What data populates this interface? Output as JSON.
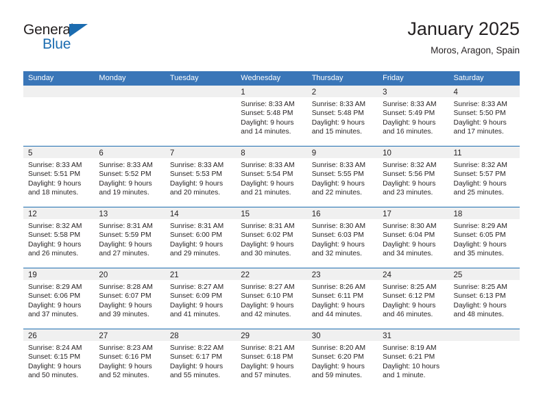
{
  "brand": {
    "name_top": "General",
    "name_bottom": "Blue",
    "triangle_icon": "brand-triangle-icon",
    "color_primary": "#1b6cb0",
    "color_text": "#231f20"
  },
  "header": {
    "title": "January 2025",
    "subtitle": "Moros, Aragon, Spain"
  },
  "calendar": {
    "header_background": "#3a76b8",
    "day_band_background": "#f0f0f0",
    "separator_color": "#1b6cb0",
    "weekdays": [
      "Sunday",
      "Monday",
      "Tuesday",
      "Wednesday",
      "Thursday",
      "Friday",
      "Saturday"
    ],
    "weeks": [
      [
        {
          "day": "",
          "lines": []
        },
        {
          "day": "",
          "lines": []
        },
        {
          "day": "",
          "lines": []
        },
        {
          "day": "1",
          "lines": [
            "Sunrise: 8:33 AM",
            "Sunset: 5:48 PM",
            "Daylight: 9 hours",
            "and 14 minutes."
          ]
        },
        {
          "day": "2",
          "lines": [
            "Sunrise: 8:33 AM",
            "Sunset: 5:48 PM",
            "Daylight: 9 hours",
            "and 15 minutes."
          ]
        },
        {
          "day": "3",
          "lines": [
            "Sunrise: 8:33 AM",
            "Sunset: 5:49 PM",
            "Daylight: 9 hours",
            "and 16 minutes."
          ]
        },
        {
          "day": "4",
          "lines": [
            "Sunrise: 8:33 AM",
            "Sunset: 5:50 PM",
            "Daylight: 9 hours",
            "and 17 minutes."
          ]
        }
      ],
      [
        {
          "day": "5",
          "lines": [
            "Sunrise: 8:33 AM",
            "Sunset: 5:51 PM",
            "Daylight: 9 hours",
            "and 18 minutes."
          ]
        },
        {
          "day": "6",
          "lines": [
            "Sunrise: 8:33 AM",
            "Sunset: 5:52 PM",
            "Daylight: 9 hours",
            "and 19 minutes."
          ]
        },
        {
          "day": "7",
          "lines": [
            "Sunrise: 8:33 AM",
            "Sunset: 5:53 PM",
            "Daylight: 9 hours",
            "and 20 minutes."
          ]
        },
        {
          "day": "8",
          "lines": [
            "Sunrise: 8:33 AM",
            "Sunset: 5:54 PM",
            "Daylight: 9 hours",
            "and 21 minutes."
          ]
        },
        {
          "day": "9",
          "lines": [
            "Sunrise: 8:33 AM",
            "Sunset: 5:55 PM",
            "Daylight: 9 hours",
            "and 22 minutes."
          ]
        },
        {
          "day": "10",
          "lines": [
            "Sunrise: 8:32 AM",
            "Sunset: 5:56 PM",
            "Daylight: 9 hours",
            "and 23 minutes."
          ]
        },
        {
          "day": "11",
          "lines": [
            "Sunrise: 8:32 AM",
            "Sunset: 5:57 PM",
            "Daylight: 9 hours",
            "and 25 minutes."
          ]
        }
      ],
      [
        {
          "day": "12",
          "lines": [
            "Sunrise: 8:32 AM",
            "Sunset: 5:58 PM",
            "Daylight: 9 hours",
            "and 26 minutes."
          ]
        },
        {
          "day": "13",
          "lines": [
            "Sunrise: 8:31 AM",
            "Sunset: 5:59 PM",
            "Daylight: 9 hours",
            "and 27 minutes."
          ]
        },
        {
          "day": "14",
          "lines": [
            "Sunrise: 8:31 AM",
            "Sunset: 6:00 PM",
            "Daylight: 9 hours",
            "and 29 minutes."
          ]
        },
        {
          "day": "15",
          "lines": [
            "Sunrise: 8:31 AM",
            "Sunset: 6:02 PM",
            "Daylight: 9 hours",
            "and 30 minutes."
          ]
        },
        {
          "day": "16",
          "lines": [
            "Sunrise: 8:30 AM",
            "Sunset: 6:03 PM",
            "Daylight: 9 hours",
            "and 32 minutes."
          ]
        },
        {
          "day": "17",
          "lines": [
            "Sunrise: 8:30 AM",
            "Sunset: 6:04 PM",
            "Daylight: 9 hours",
            "and 34 minutes."
          ]
        },
        {
          "day": "18",
          "lines": [
            "Sunrise: 8:29 AM",
            "Sunset: 6:05 PM",
            "Daylight: 9 hours",
            "and 35 minutes."
          ]
        }
      ],
      [
        {
          "day": "19",
          "lines": [
            "Sunrise: 8:29 AM",
            "Sunset: 6:06 PM",
            "Daylight: 9 hours",
            "and 37 minutes."
          ]
        },
        {
          "day": "20",
          "lines": [
            "Sunrise: 8:28 AM",
            "Sunset: 6:07 PM",
            "Daylight: 9 hours",
            "and 39 minutes."
          ]
        },
        {
          "day": "21",
          "lines": [
            "Sunrise: 8:27 AM",
            "Sunset: 6:09 PM",
            "Daylight: 9 hours",
            "and 41 minutes."
          ]
        },
        {
          "day": "22",
          "lines": [
            "Sunrise: 8:27 AM",
            "Sunset: 6:10 PM",
            "Daylight: 9 hours",
            "and 42 minutes."
          ]
        },
        {
          "day": "23",
          "lines": [
            "Sunrise: 8:26 AM",
            "Sunset: 6:11 PM",
            "Daylight: 9 hours",
            "and 44 minutes."
          ]
        },
        {
          "day": "24",
          "lines": [
            "Sunrise: 8:25 AM",
            "Sunset: 6:12 PM",
            "Daylight: 9 hours",
            "and 46 minutes."
          ]
        },
        {
          "day": "25",
          "lines": [
            "Sunrise: 8:25 AM",
            "Sunset: 6:13 PM",
            "Daylight: 9 hours",
            "and 48 minutes."
          ]
        }
      ],
      [
        {
          "day": "26",
          "lines": [
            "Sunrise: 8:24 AM",
            "Sunset: 6:15 PM",
            "Daylight: 9 hours",
            "and 50 minutes."
          ]
        },
        {
          "day": "27",
          "lines": [
            "Sunrise: 8:23 AM",
            "Sunset: 6:16 PM",
            "Daylight: 9 hours",
            "and 52 minutes."
          ]
        },
        {
          "day": "28",
          "lines": [
            "Sunrise: 8:22 AM",
            "Sunset: 6:17 PM",
            "Daylight: 9 hours",
            "and 55 minutes."
          ]
        },
        {
          "day": "29",
          "lines": [
            "Sunrise: 8:21 AM",
            "Sunset: 6:18 PM",
            "Daylight: 9 hours",
            "and 57 minutes."
          ]
        },
        {
          "day": "30",
          "lines": [
            "Sunrise: 8:20 AM",
            "Sunset: 6:20 PM",
            "Daylight: 9 hours",
            "and 59 minutes."
          ]
        },
        {
          "day": "31",
          "lines": [
            "Sunrise: 8:19 AM",
            "Sunset: 6:21 PM",
            "Daylight: 10 hours",
            "and 1 minute."
          ]
        },
        {
          "day": "",
          "lines": []
        }
      ]
    ]
  }
}
